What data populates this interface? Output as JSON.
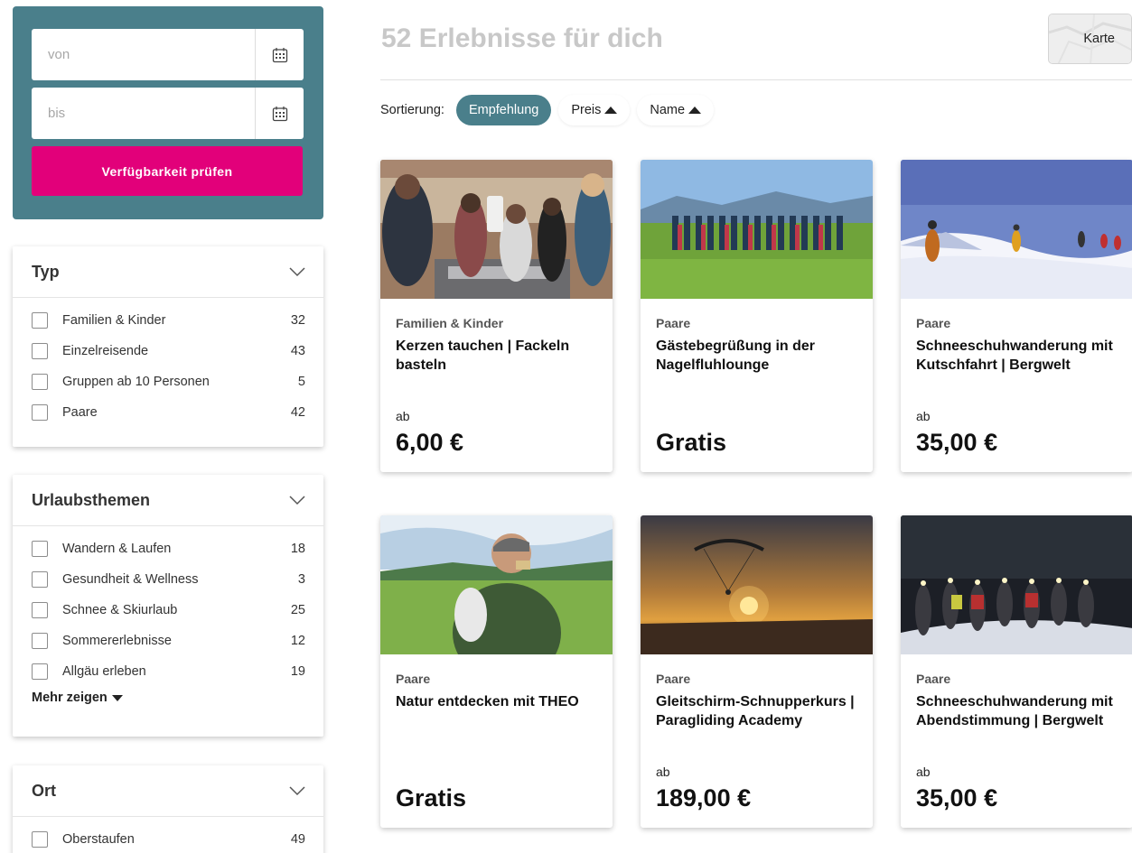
{
  "dates": {
    "from_placeholder": "von",
    "to_placeholder": "bis",
    "check_label": "Verfügbarkeit prüfen"
  },
  "filters": {
    "typ": {
      "title": "Typ",
      "items": [
        {
          "label": "Familien & Kinder",
          "count": "32"
        },
        {
          "label": "Einzelreisende",
          "count": "43"
        },
        {
          "label": "Gruppen ab 10 Personen",
          "count": "5"
        },
        {
          "label": "Paare",
          "count": "42"
        }
      ]
    },
    "themen": {
      "title": "Urlaubsthemen",
      "items": [
        {
          "label": "Wandern & Laufen",
          "count": "18"
        },
        {
          "label": "Gesundheit & Wellness",
          "count": "3"
        },
        {
          "label": "Schnee & Skiurlaub",
          "count": "25"
        },
        {
          "label": "Sommererlebnisse",
          "count": "12"
        },
        {
          "label": "Allgäu erleben",
          "count": "19"
        }
      ],
      "more_label": "Mehr zeigen"
    },
    "ort": {
      "title": "Ort",
      "items": [
        {
          "label": "Oberstaufen",
          "count": "49"
        }
      ]
    }
  },
  "results": {
    "title": "52 Erlebnisse für dich",
    "map_label": "Karte"
  },
  "sort": {
    "label": "Sortierung:",
    "options": [
      "Empfehlung",
      "Preis",
      "Name"
    ]
  },
  "experiences": [
    {
      "category": "Familien & Kinder",
      "title": "Kerzen tauchen | Fackeln basteln",
      "ab": "ab",
      "price": "6,00 €"
    },
    {
      "category": "Paare",
      "title": "Gästebegrüßung in der Nagelfluhlounge",
      "ab": "",
      "price": "Gratis"
    },
    {
      "category": "Paare",
      "title": "Schneeschuhwanderung mit Kutschfahrt | Bergwelt",
      "ab": "ab",
      "price": "35,00 €"
    },
    {
      "category": "Paare",
      "title": "Natur entdecken mit THEO",
      "ab": "",
      "price": "Gratis"
    },
    {
      "category": "Paare",
      "title": "Gleitschirm-Schnupperkurs | Paragliding Academy",
      "ab": "ab",
      "price": "189,00 €"
    },
    {
      "category": "Paare",
      "title": "Schneeschuhwanderung mit Abendstimmung | Bergwelt",
      "ab": "ab",
      "price": "35,00 €"
    }
  ],
  "colors": {
    "panel": "#4a7f8b",
    "cta": "#e2007a",
    "active_sort": "#4a7f8b"
  }
}
